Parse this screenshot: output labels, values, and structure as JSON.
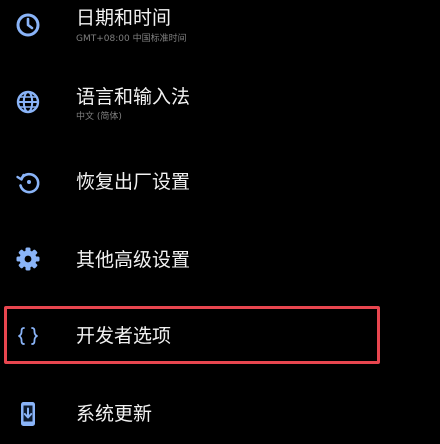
{
  "settings": {
    "items": [
      {
        "title": "日期和时间",
        "subtitle": "GMT+08:00 中国标准时间",
        "icon": "clock-icon"
      },
      {
        "title": "语言和输入法",
        "subtitle": "中文 (简体)",
        "icon": "globe-icon"
      },
      {
        "title": "恢复出厂设置",
        "icon": "restore-icon"
      },
      {
        "title": "其他高级设置",
        "icon": "gear-icon"
      },
      {
        "title": "开发者选项",
        "icon": "braces-icon"
      },
      {
        "title": "系统更新",
        "icon": "phone-update-icon"
      }
    ],
    "highlighted_item": "开发者选项"
  },
  "colors": {
    "background": "#000000",
    "icon_accent": "#8ab4f8",
    "title_text": "#f2f2f2",
    "subtitle_text": "#7f7f7f",
    "highlight_border": "#e8464f"
  }
}
